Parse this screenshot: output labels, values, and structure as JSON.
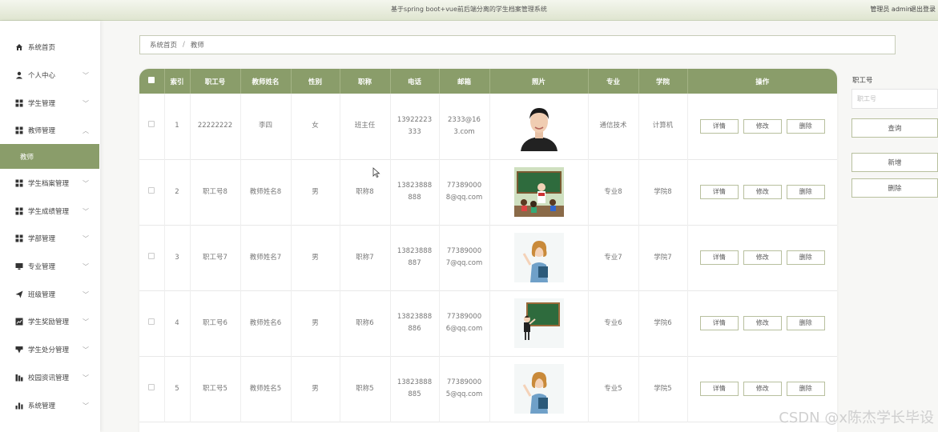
{
  "header": {
    "title": "基于spring boot+vue前后端分离的学生档案管理系统",
    "user": "管理员 admin",
    "logout": "退出登录"
  },
  "sidebar": {
    "items": [
      {
        "label": "系统首页",
        "icon": "home-icon",
        "chevron": false
      },
      {
        "label": "个人中心",
        "icon": "user-icon",
        "chevron": true
      },
      {
        "label": "学生管理",
        "icon": "grid-icon",
        "chevron": true
      },
      {
        "label": "教师管理",
        "icon": "grid-icon",
        "chevron": true,
        "expanded": true
      },
      {
        "label": "学生档案管理",
        "icon": "grid-icon",
        "chevron": true
      },
      {
        "label": "学生成绩管理",
        "icon": "grid-icon",
        "chevron": true
      },
      {
        "label": "学部管理",
        "icon": "grid-icon",
        "chevron": true
      },
      {
        "label": "专业管理",
        "icon": "monitor-icon",
        "chevron": true
      },
      {
        "label": "班级管理",
        "icon": "send-icon",
        "chevron": true
      },
      {
        "label": "学生奖励管理",
        "icon": "chart-icon",
        "chevron": true
      },
      {
        "label": "学生处分管理",
        "icon": "filter-icon",
        "chevron": true
      },
      {
        "label": "校园资讯管理",
        "icon": "bars-icon",
        "chevron": true
      },
      {
        "label": "系统管理",
        "icon": "stats-icon",
        "chevron": true
      }
    ],
    "active_sub": "教师"
  },
  "breadcrumb": {
    "home": "系统首页",
    "sep": "/",
    "current": "教师"
  },
  "table": {
    "headers": [
      "索引",
      "职工号",
      "教师姓名",
      "性别",
      "职称",
      "电话",
      "邮箱",
      "照片",
      "专业",
      "学院",
      "操作"
    ],
    "actions": {
      "detail": "详情",
      "edit": "修改",
      "delete": "删除"
    },
    "rows": [
      {
        "index": "1",
        "job_no": "22222222",
        "name": "李四",
        "gender": "女",
        "title": "班主任",
        "phone": "13922223333",
        "email": "2333@163.com",
        "photo": "man-portrait",
        "major": "通信技术",
        "college": "计算机"
      },
      {
        "index": "2",
        "job_no": "职工号8",
        "name": "教师姓名8",
        "gender": "男",
        "title": "职称8",
        "phone": "13823888888",
        "email": "773890008@qq.com",
        "photo": "classroom-teacher",
        "major": "专业8",
        "college": "学院8"
      },
      {
        "index": "3",
        "job_no": "职工号7",
        "name": "教师姓名7",
        "gender": "男",
        "title": "职称7",
        "phone": "13823888887",
        "email": "773890007@qq.com",
        "photo": "woman-teacher",
        "major": "专业7",
        "college": "学院7"
      },
      {
        "index": "4",
        "job_no": "职工号6",
        "name": "教师姓名6",
        "gender": "男",
        "title": "职称6",
        "phone": "13823888886",
        "email": "773890006@qq.com",
        "photo": "blackboard-teacher",
        "major": "专业6",
        "college": "学院6"
      },
      {
        "index": "5",
        "job_no": "职工号5",
        "name": "教师姓名5",
        "gender": "男",
        "title": "职称5",
        "phone": "13823888885",
        "email": "773890005@qq.com",
        "photo": "woman-teacher",
        "major": "专业5",
        "college": "学院5"
      }
    ]
  },
  "search": {
    "label": "职工号",
    "placeholder": "职工号",
    "query": "查询",
    "add": "新增",
    "delete": "删除"
  },
  "watermark": "CSDN @x陈杰学长毕设",
  "colors": {
    "accent": "#8a9d6a",
    "topbar": "#dfe5d0"
  }
}
